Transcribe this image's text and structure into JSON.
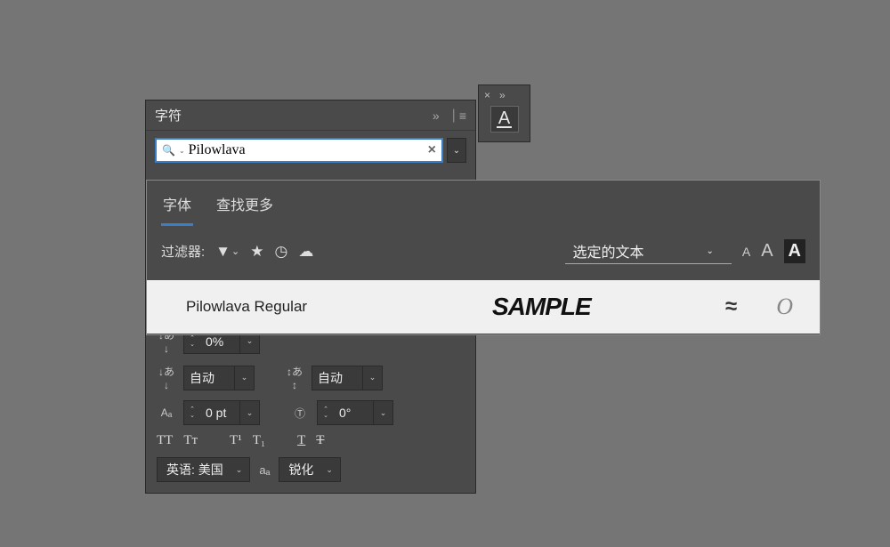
{
  "mini_panel": {
    "close_glyph": "×",
    "expand_glyph": "»",
    "letter": "A"
  },
  "char_panel": {
    "title": "字符",
    "collapse_glyph": "»",
    "menu_glyph": "≡",
    "search": {
      "value": "Pilowlava",
      "clear_glyph": "×"
    }
  },
  "font_dropdown": {
    "tabs": [
      {
        "label": "字体",
        "active": true
      },
      {
        "label": "查找更多",
        "active": false
      }
    ],
    "filter_label": "过滤器:",
    "selected_text_label": "选定的文本",
    "result": {
      "name": "Pilowlava Regular",
      "sample": "SAMPLE",
      "approx": "≈",
      "variant": "O"
    }
  },
  "controls": {
    "baseline_shift_pct": "0%",
    "kerning": "自动",
    "tracking": "自动",
    "baseline_pt": "0 pt",
    "rotation": "0°",
    "language": "英语: 美国",
    "antialias": "锐化",
    "type_buttons": {
      "allcaps": "TT",
      "smallcaps": "Tᴛ",
      "super": "T¹",
      "sub": "T₁",
      "underline": "T",
      "strike": "T"
    }
  }
}
